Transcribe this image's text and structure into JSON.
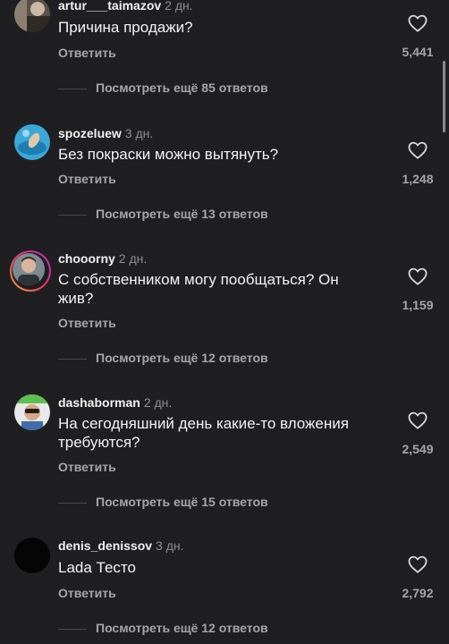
{
  "comments": [
    {
      "username": "artur___taimazov",
      "time": "2 дн.",
      "text": "Причина продажи?",
      "reply_label": "Ответить",
      "likes": "5,441",
      "view_more": "Посмотреть ещё 85 ответов"
    },
    {
      "username": "spozeluew",
      "time": "3 дн.",
      "text": "Без покраски можно вытянуть?",
      "reply_label": "Ответить",
      "likes": "1,248",
      "view_more": "Посмотреть ещё 13 ответов"
    },
    {
      "username": "chooorny",
      "time": "2 дн.",
      "text": "С собственником могу пообщаться? Он жив?",
      "reply_label": "Ответить",
      "likes": "1,159",
      "view_more": "Посмотреть ещё 12 ответов"
    },
    {
      "username": "dashaborman",
      "time": "2 дн.",
      "text": "На сегодняшний день какие-то вложения требуются?",
      "reply_label": "Ответить",
      "likes": "2,549",
      "view_more": "Посмотреть ещё 15 ответов"
    },
    {
      "username": "denis_denissov",
      "time": "3 дн.",
      "text": "Lada Тесто",
      "reply_label": "Ответить",
      "likes": "2,792",
      "view_more": "Посмотреть ещё 12 ответов"
    }
  ],
  "icons": {
    "like": "heart-outline-icon"
  },
  "colors": {
    "background": "#1f1f22",
    "primary_text": "#f2f2f2",
    "secondary_text": "#a5a5aa",
    "story_ring": "#e8336a"
  }
}
